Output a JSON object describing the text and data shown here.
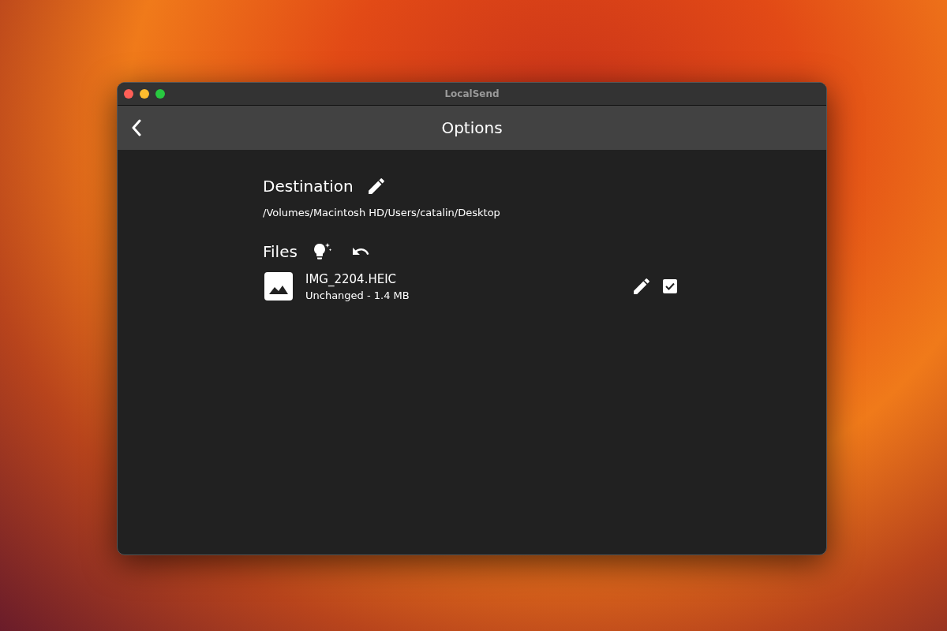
{
  "window": {
    "title": "LocalSend"
  },
  "app_bar": {
    "title": "Options"
  },
  "destination": {
    "heading": "Destination",
    "path": "/Volumes/Macintosh HD/Users/catalin/Desktop"
  },
  "files_section": {
    "heading": "Files"
  },
  "files": [
    {
      "name": "IMG_2204.HEIC",
      "info": "Unchanged - 1.4 MB",
      "checked": true
    }
  ]
}
